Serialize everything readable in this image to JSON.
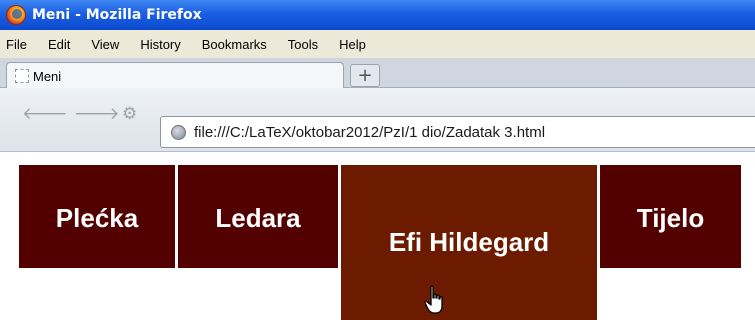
{
  "window": {
    "title": "Meni - Mozilla Firefox"
  },
  "menubar": {
    "items": [
      "File",
      "Edit",
      "View",
      "History",
      "Bookmarks",
      "Tools",
      "Help"
    ]
  },
  "tabs": [
    {
      "label": "Meni"
    }
  ],
  "newtab": {
    "label": "+"
  },
  "nav": {
    "back": "🡐",
    "forward": "🡒",
    "extra": "⚙"
  },
  "urlbar": {
    "value": "file:///C:/LaTeX/oktobar2012/PzI/1 dio/Zadatak 3.html"
  },
  "page_menu": {
    "items": [
      "Plećka",
      "Ledara",
      "Efi Hildegard",
      "Tijelo"
    ]
  },
  "colors": {
    "menu_bg": "#530000",
    "menu_active": "#6c1a00",
    "titlebar": "#1c5fe2"
  },
  "cursor": {
    "icon": "hand-pointer-icon"
  }
}
